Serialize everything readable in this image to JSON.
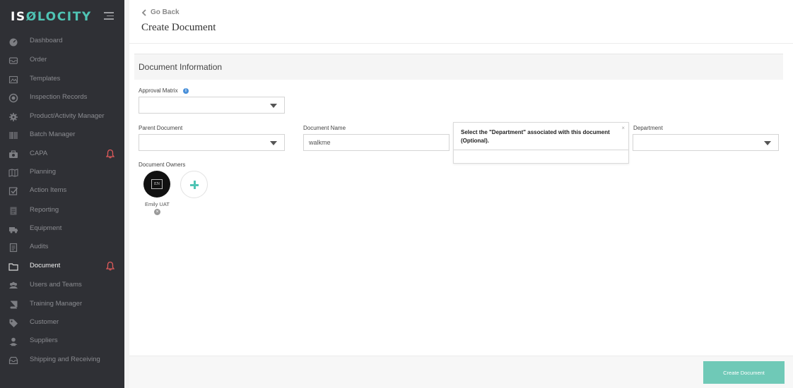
{
  "brand": {
    "name_prefix": "IS",
    "name_o": "Ø",
    "name_suffix": "LOCITY",
    "accent": "#4fc4b4"
  },
  "sidebar": {
    "items": [
      {
        "label": "Dashboard",
        "icon": "dashboard-icon"
      },
      {
        "label": "Order",
        "icon": "order-icon"
      },
      {
        "label": "Templates",
        "icon": "templates-icon"
      },
      {
        "label": "Inspection Records",
        "icon": "inspection-icon"
      },
      {
        "label": "Product/Activity Manager",
        "icon": "gear-icon"
      },
      {
        "label": "Batch Manager",
        "icon": "barcode-icon"
      },
      {
        "label": "CAPA",
        "icon": "capa-icon",
        "alert": true
      },
      {
        "label": "Planning",
        "icon": "map-icon"
      },
      {
        "label": "Action Items",
        "icon": "checkbox-icon"
      },
      {
        "label": "Reporting",
        "icon": "report-icon"
      },
      {
        "label": "Equipment",
        "icon": "truck-icon"
      },
      {
        "label": "Audits",
        "icon": "audit-icon"
      },
      {
        "label": "Document",
        "icon": "folder-icon",
        "alert": true,
        "active": true
      },
      {
        "label": "Users and Teams",
        "icon": "users-icon"
      },
      {
        "label": "Training Manager",
        "icon": "book-icon"
      },
      {
        "label": "Customer",
        "icon": "tag-icon"
      },
      {
        "label": "Suppliers",
        "icon": "supplier-icon"
      },
      {
        "label": "Shipping and Receiving",
        "icon": "inbox-icon"
      }
    ]
  },
  "header": {
    "go_back": "Go Back",
    "title": "Create Document"
  },
  "section": {
    "title": "Document Information"
  },
  "form": {
    "approval_matrix_label": "Approval Matrix",
    "approval_matrix_info": "i",
    "parent_document_label": "Parent Document",
    "document_name_label": "Document Name",
    "document_name_value": "walkme",
    "department_label": "Department",
    "document_owners_label": "Document Owners",
    "owner": {
      "initials": "EN",
      "name": "Emily UAT"
    }
  },
  "tooltip": {
    "text": "Select the \"Department\" associated with this document (Optional).",
    "close": "×"
  },
  "footer": {
    "create_label": "Create Document"
  }
}
